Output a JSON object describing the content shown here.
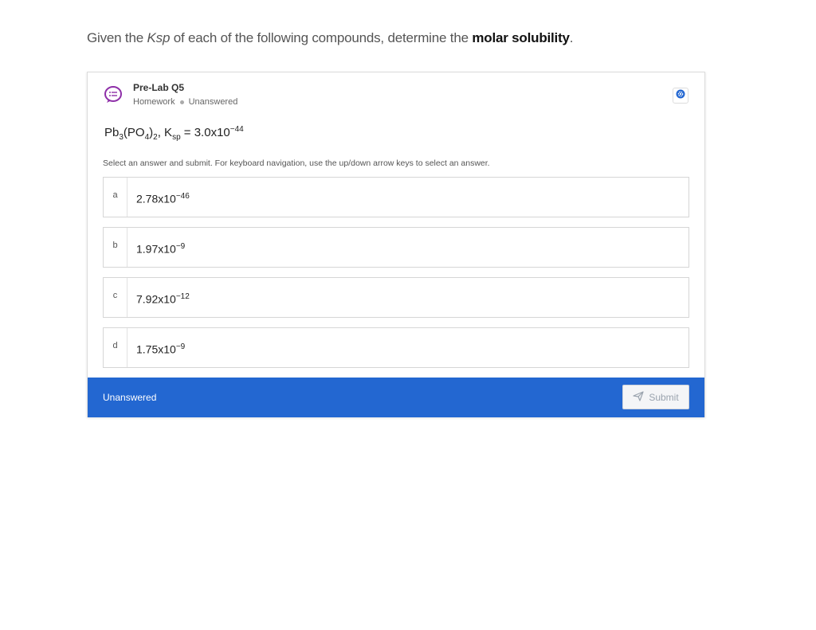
{
  "prompt": {
    "part1": "Given the ",
    "ksp": "Ksp",
    "part2": " of each of the following compounds, determine the ",
    "bold": "molar solubility",
    "part3": "."
  },
  "card": {
    "title": "Pre-Lab Q5",
    "category": "Homework",
    "status": "Unanswered",
    "question": {
      "compound_base": "Pb",
      "sub1": "3",
      "paren_open": "(PO",
      "sub2": "4",
      "paren_close": ")",
      "sub3": "2",
      "sep": ", K",
      "ksp_sub": "sp",
      "equals": " = 3.0x10",
      "exponent": "−44"
    },
    "instructions": "Select an answer and submit. For keyboard navigation, use the up/down arrow keys to select an answer.",
    "options": [
      {
        "letter": "a",
        "base": "2.78x10",
        "exp": "−46"
      },
      {
        "letter": "b",
        "base": "1.97x10",
        "exp": "−9"
      },
      {
        "letter": "c",
        "base": "7.92x10",
        "exp": "−12"
      },
      {
        "letter": "d",
        "base": "1.75x10",
        "exp": "−9"
      }
    ],
    "footer_status": "Unanswered",
    "submit_label": "Submit"
  },
  "colors": {
    "footer": "#2367d1",
    "icon": "#8e2fa8"
  },
  "icons": {
    "question": "question-chat-icon",
    "settings": "settings-icon",
    "submit": "send-icon"
  }
}
